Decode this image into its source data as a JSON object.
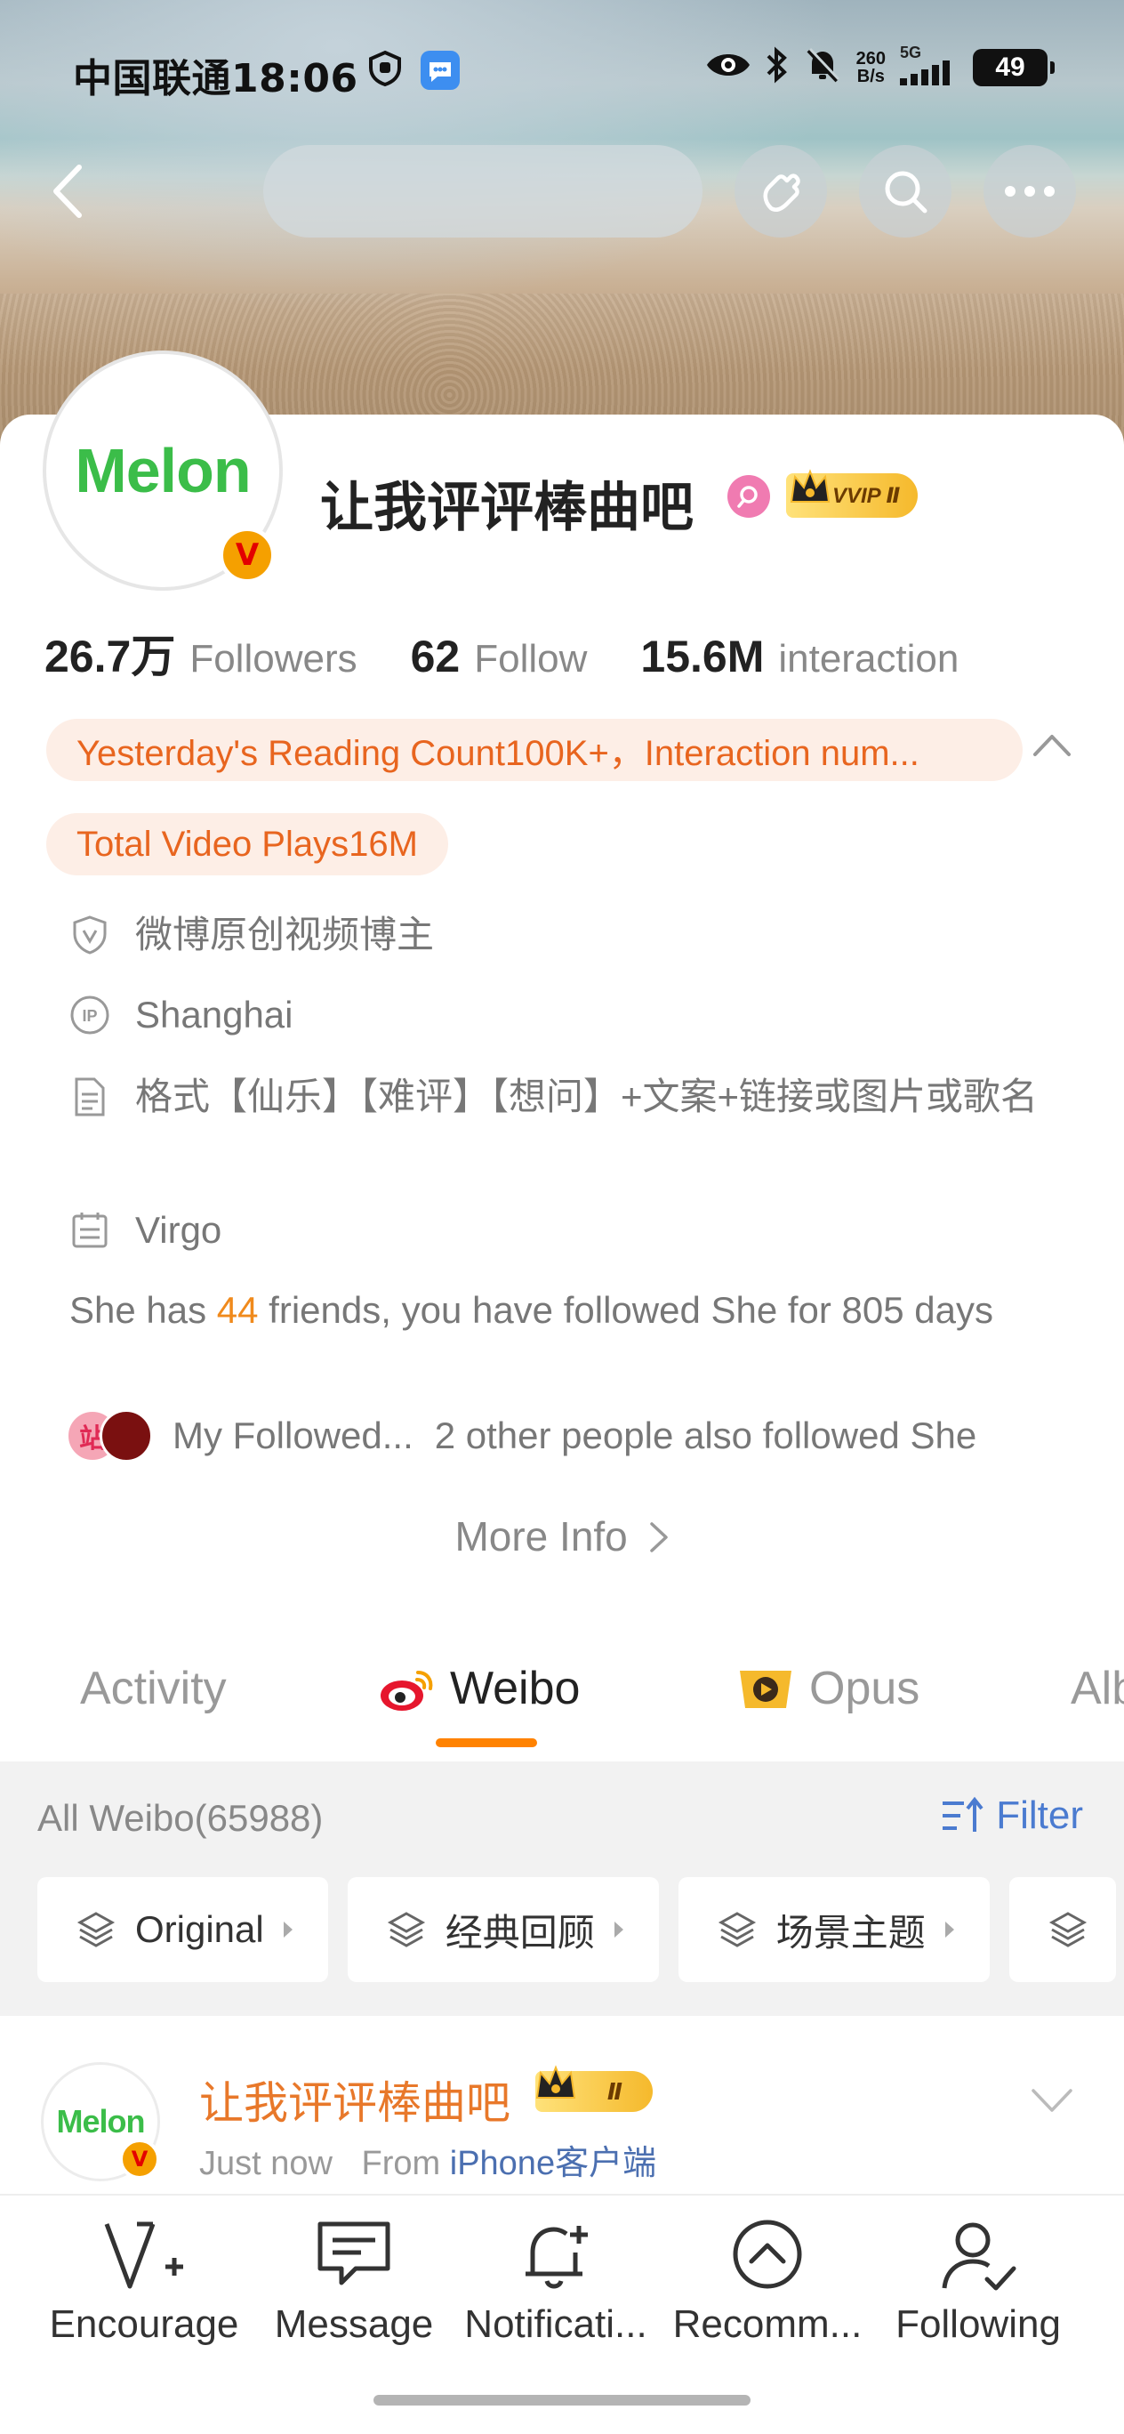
{
  "status_bar": {
    "carrier_time": "中国联通18:06",
    "net_speed_top": "260",
    "net_speed_bottom": "B/s",
    "network": "5G",
    "battery": "49"
  },
  "profile": {
    "name": "让我评评棒曲吧",
    "vip_badge": "VVIP Ⅱ",
    "avatar_logo": "Melon",
    "verified_mark": "V"
  },
  "stats": [
    {
      "value": "26.7万",
      "label": "Followers"
    },
    {
      "value": "62",
      "label": "Follow"
    },
    {
      "value": "15.6M",
      "label": "interaction"
    }
  ],
  "pills": {
    "reading": "Yesterday's Reading Count100K+，Interaction num...",
    "video": "Total Video Plays16M"
  },
  "info": {
    "verification": "微博原创视频博主",
    "ip": "Shanghai",
    "bio": "格式【仙乐】【难评】【想问】+文案+链接或图片或歌名",
    "zodiac": "Virgo",
    "friends_prefix": "She has ",
    "friends_count": "44",
    "friends_suffix": " friends, you have followed She for 805 days",
    "mutual_avatar_1": "站",
    "mutual_label": "My Followed...",
    "mutual_others": "2 other people also followed She",
    "more_info": "More Info"
  },
  "tabs": [
    {
      "label": "Activity",
      "active": false
    },
    {
      "label": "Weibo",
      "active": true
    },
    {
      "label": "Opus",
      "active": false
    },
    {
      "label": "Alb",
      "active": false
    }
  ],
  "feed": {
    "all_weibo": "All Weibo(65988)",
    "filter": "Filter",
    "chips": [
      "Original",
      "经典回顾",
      "场景主题"
    ]
  },
  "post": {
    "name": "让我评评棒曲吧",
    "badge": "Ⅱ",
    "time": "Just now",
    "from_label": "From",
    "source": "iPhone客户端"
  },
  "bottom_nav": [
    {
      "label": "Encourage",
      "icon": "encourage-icon"
    },
    {
      "label": "Message",
      "icon": "message-icon"
    },
    {
      "label": "Notificati...",
      "icon": "bell-add-icon"
    },
    {
      "label": "Recomm...",
      "icon": "chevron-up-circle-icon"
    },
    {
      "label": "Following",
      "icon": "user-check-icon"
    }
  ],
  "colors": {
    "accent_orange": "#ff8200",
    "pill_text": "#e8651f",
    "link_blue": "#4b7bd0",
    "melon_green": "#3bbd49"
  }
}
